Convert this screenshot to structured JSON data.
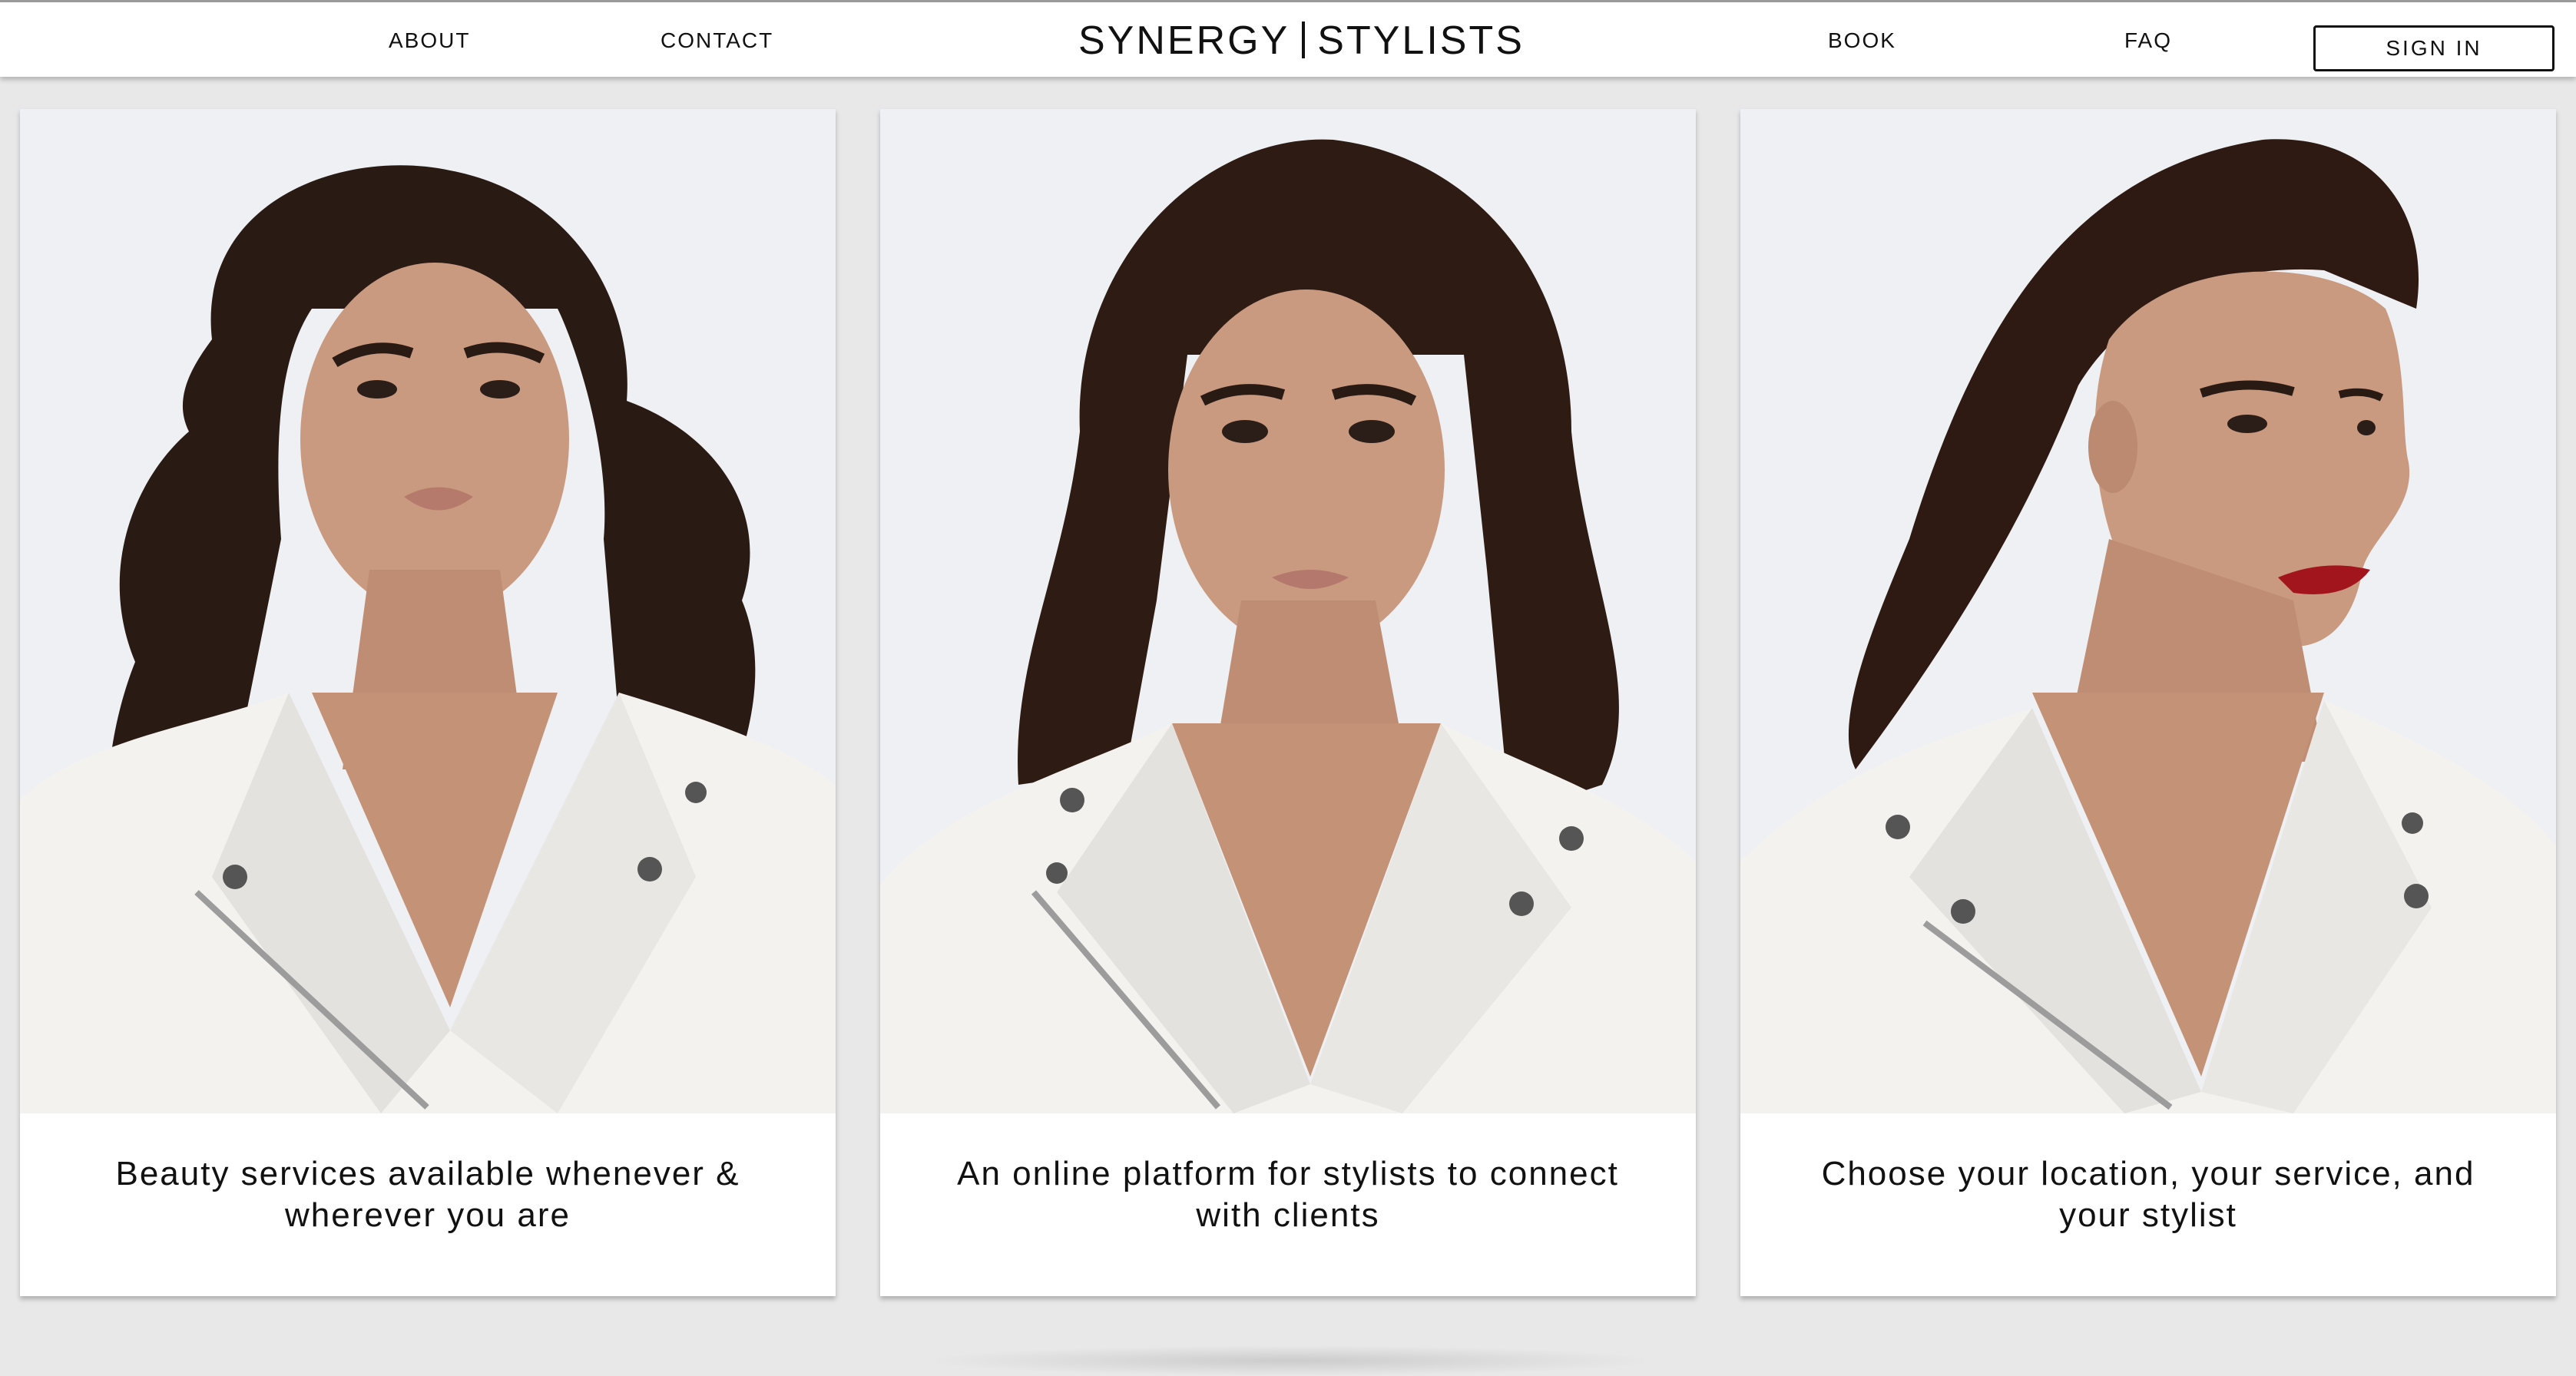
{
  "header": {
    "brand_left": "SYNERGY",
    "brand_right": "STYLISTS",
    "nav_left": [
      "ABOUT",
      "CONTACT"
    ],
    "nav_right": [
      "BOOK",
      "FAQ"
    ],
    "signin_label": "SIGN IN"
  },
  "cards": [
    {
      "caption": "Beauty services available whenever & wherever you are",
      "photo": "model-curly-hair-white-jacket"
    },
    {
      "caption": "An online platform for stylists to connect with clients",
      "photo": "model-voluminous-hair-white-jacket"
    },
    {
      "caption": "Choose your location, your service, and your stylist",
      "photo": "model-slicked-hair-profile-white-jacket"
    }
  ],
  "colors": {
    "page_background": "#e8e8e8",
    "card_background": "#ffffff",
    "text": "#111111",
    "photo_backdrop": "#eef0f4",
    "jacket": "#f3f2ef",
    "hair": "#2a1a14",
    "skin": "#c99a80",
    "lips_red": "#a3151c"
  }
}
